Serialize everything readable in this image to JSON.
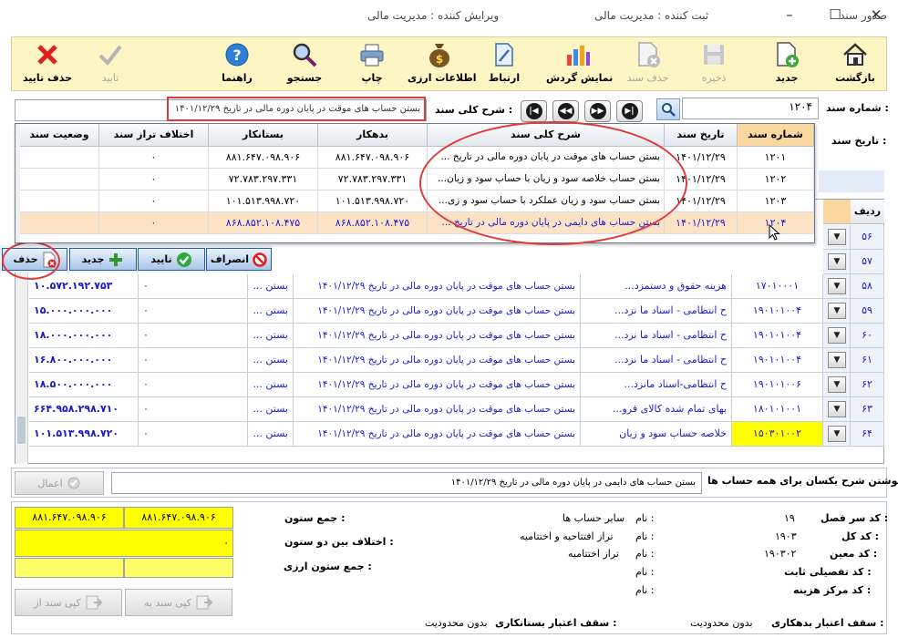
{
  "window": {
    "title": "صدور سند",
    "registrar": "ثبت کننده : مدیریت مالی",
    "editor": "ویرایش کننده : مدیریت مالی",
    "controls": [
      "–",
      "☐",
      "✕"
    ]
  },
  "toolbar": {
    "back": "بازگشت",
    "new": "جدید",
    "save": "ذخیره",
    "delete_doc": "حذف سند",
    "show_turnover": "نمایش گردش",
    "link": "ارتباط",
    "currency_info": "اطلاعات ارزی",
    "print": "چاپ",
    "search": "جستجو",
    "help": "راهنما",
    "confirm": "تایید",
    "delete_confirm": "حذف تایید"
  },
  "search_row": {
    "doc_number_label": "شماره سند :",
    "doc_number_value": "۱۲۰۴",
    "general_desc_label": "شرح کلی سند :",
    "general_desc_value": "بستن حساب های موقت در پایان دوره مالی در تاریخ ۱۴۰۱/۱۲/۲۹",
    "doc_date_label": "تاریخ سند :",
    "nav": [
      "|◀",
      "◀◀",
      "▶▶",
      "▶|"
    ]
  },
  "dropdown_grid": {
    "headers": [
      "شماره سند",
      "تاریخ سند",
      "شرح کلی سند",
      "بدهکار",
      "بستانکار",
      "اختلاف تراز سند",
      "وضعیت سند"
    ],
    "rows": [
      [
        "۱۲۰۱",
        "۱۴۰۱/۱۲/۲۹",
        "بستن حساب های موقت در پایان دوره مالی در تاریخ ...",
        "۸۸۱.۶۴۷.۰۹۸.۹۰۶",
        "۸۸۱.۶۴۷.۰۹۸.۹۰۶",
        "۰",
        ""
      ],
      [
        "۱۲۰۲",
        "۱۴۰۱/۱۲/۲۹",
        "بستن حساب خلاصه سود و زیان با حساب سود و زیان...",
        "۷۲.۷۸۳.۲۹۷.۳۳۱",
        "۷۲.۷۸۳.۲۹۷.۳۳۱",
        "۰",
        ""
      ],
      [
        "۱۲۰۳",
        "۱۴۰۱/۱۲/۲۹",
        "بستن حساب سود و زیان عملکرد با حساب سود و زی...",
        "۱۰۱.۵۱۳.۹۹۸.۷۲۰",
        "۱۰۱.۵۱۳.۹۹۸.۷۲۰",
        "۰",
        ""
      ],
      [
        "۱۲۰۴",
        "۱۴۰۱/۱۲/۲۹",
        "بستن حساب های دایمی در پایان دوره مالی در تاریخ ...",
        "۸۶۸.۸۵۲.۱۰۸.۴۷۵",
        "۸۶۸.۸۵۲.۱۰۸.۴۷۵",
        "۰",
        ""
      ]
    ]
  },
  "actions": {
    "cancel": "انصراف",
    "confirm": "تایید",
    "new": "جدید",
    "delete": "حذف"
  },
  "main_grid": {
    "row_header": "ردیف",
    "rows": [
      {
        "no": "۵۶",
        "code": "",
        "name": "",
        "desc": "",
        "debit": "",
        "credit": ""
      },
      {
        "no": "۵۷",
        "code": "",
        "name": "",
        "desc": "",
        "debit": "",
        "credit": ""
      },
      {
        "no": "۵۸",
        "code": "۱۷۰۱۰۰۰۱",
        "name": "هزینه حقوق و دستمزد...",
        "desc": "بستن حساب های موقت در پایان دوره مالی در تاریخ ۱۴۰۱/۱۲/۲۹",
        "debit": "بستن ...",
        "credit": "۰",
        "amount": "۱۰.۵۷۲.۱۹۲.۷۵۳"
      },
      {
        "no": "۵۹",
        "code": "۱۹۰۱۰۱۰۰۴",
        "name": "ح انتظامی - اسناد ما نزد...",
        "desc": "بستن حساب های موقت در پایان دوره مالی در تاریخ ۱۴۰۱/۱۲/۲۹",
        "debit": "بستن ...",
        "credit": "۰",
        "amount": "۱۵.۰۰۰.۰۰۰.۰۰۰"
      },
      {
        "no": "۶۰",
        "code": "۱۹۰۱۰۱۰۰۴",
        "name": "ح انتظامی - اسناد ما نزد...",
        "desc": "بستن حساب های موقت در پایان دوره مالی در تاریخ ۱۴۰۱/۱۲/۲۹",
        "debit": "بستن ...",
        "credit": "۰",
        "amount": "۱۸.۰۰۰.۰۰۰.۰۰۰"
      },
      {
        "no": "۶۱",
        "code": "۱۹۰۱۰۱۰۰۴",
        "name": "ح انتظامی - اسناد ما نزد...",
        "desc": "بستن حساب های موقت در پایان دوره مالی در تاریخ ۱۴۰۱/۱۲/۲۹",
        "debit": "بستن ...",
        "credit": "۰",
        "amount": "۱۶.۸۰۰.۰۰۰.۰۰۰"
      },
      {
        "no": "۶۲",
        "code": "۱۹۰۱۰۱۰۰۶",
        "name": "ح انتظامی-اسناد مانزد...",
        "desc": "بستن حساب های موقت در پایان دوره مالی در تاریخ ۱۴۰۱/۱۲/۲۹",
        "debit": "بستن ...",
        "credit": "۰",
        "amount": "۱۸.۵۰۰.۰۰۰.۰۰۰"
      },
      {
        "no": "۶۳",
        "code": "۱۸۰۱۰۱۰۰۱",
        "name": "بهای تمام شده کالای فرو...",
        "desc": "بستن حساب های موقت در پایان دوره مالی در تاریخ ۱۴۰۱/۱۲/۲۹",
        "debit": "بستن ...",
        "credit": "۰",
        "amount": "۶۶۴.۹۵۸.۲۹۸.۷۱۰"
      },
      {
        "no": "۶۴",
        "code": "۱۵۰۳۰۱۰۰۲",
        "name": "خلاصه حساب سود و زیان",
        "desc": "بستن حساب های موقت در پایان دوره مالی در تاریخ ۱۴۰۱/۱۲/۲۹",
        "debit": "بستن ...",
        "credit": "۰",
        "amount": "۱۰۱.۵۱۳.۹۹۸.۷۲۰"
      }
    ]
  },
  "uniform_desc": {
    "label": "نوشتن شرح یکسان برای همه حساب ها :",
    "value": "بستن حساب های دایمی در پایان دوره مالی در تاریخ ۱۴۰۱/۱۲/۲۹",
    "apply_button": "اعمال"
  },
  "totals": {
    "sum_label": "جمع ستون :",
    "sum_debit": "۸۸۱.۶۴۷.۰۹۸.۹۰۶",
    "sum_credit": "۸۸۱.۶۴۷.۰۹۸.۹۰۶",
    "diff_label": "اختلاف بین دو ستون :",
    "diff_value": "۰",
    "currency_label": "جمع ستون ارزی :",
    "copy_to": "کپی سند به",
    "copy_from": "کپی سند از"
  },
  "account_info": {
    "season_code_label": "کد سر فصل :",
    "season_code": "۱۹",
    "general_code_label": "کد کل :",
    "general_code": "۱۹۰۳",
    "specific_code_label": "کد معین :",
    "specific_code": "۱۹۰۳۰۲",
    "fixed_detail_label": "کد تفصیلی ثابت :",
    "cost_center_label": "کد مرکز هزینه :",
    "name_label": "نام :",
    "names": [
      "سایر حساب ها",
      "تراز افتتاحیه و اختتامیه",
      "تراز اختتامیه",
      "",
      ""
    ],
    "debit_limit_label": "سقف اعتبار بدهکاری :",
    "debit_limit": "بدون محدودیت",
    "credit_limit_label": "سقف اعتبار بستانکاری :",
    "credit_limit": "بدون محدودیت"
  }
}
